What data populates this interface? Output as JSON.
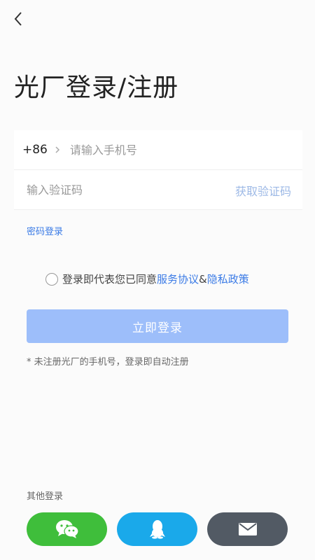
{
  "header": {
    "back_icon": "chevron-left-icon"
  },
  "page": {
    "title": "光厂登录/注册"
  },
  "form": {
    "country_code": "+86",
    "phone_placeholder": "请输入手机号",
    "code_placeholder": "输入验证码",
    "get_code_label": "获取验证码"
  },
  "password_login_label": "密码登录",
  "agreement": {
    "prefix": "登录即代表您已同意",
    "service_link": "服务协议",
    "connector": "&",
    "privacy_link": "隐私政策"
  },
  "login_button_label": "立即登录",
  "register_note": "* 未注册光厂的手机号，登录即自动注册",
  "other_login": {
    "label": "其他登录",
    "buttons": [
      {
        "icon": "wechat-icon",
        "color": "#3fbe3b"
      },
      {
        "icon": "qq-icon",
        "color": "#1aa9ea"
      },
      {
        "icon": "mail-icon",
        "color": "#525a64"
      }
    ]
  },
  "colors": {
    "accent": "#3b7be6",
    "button_disabled": "#9dbefa"
  }
}
